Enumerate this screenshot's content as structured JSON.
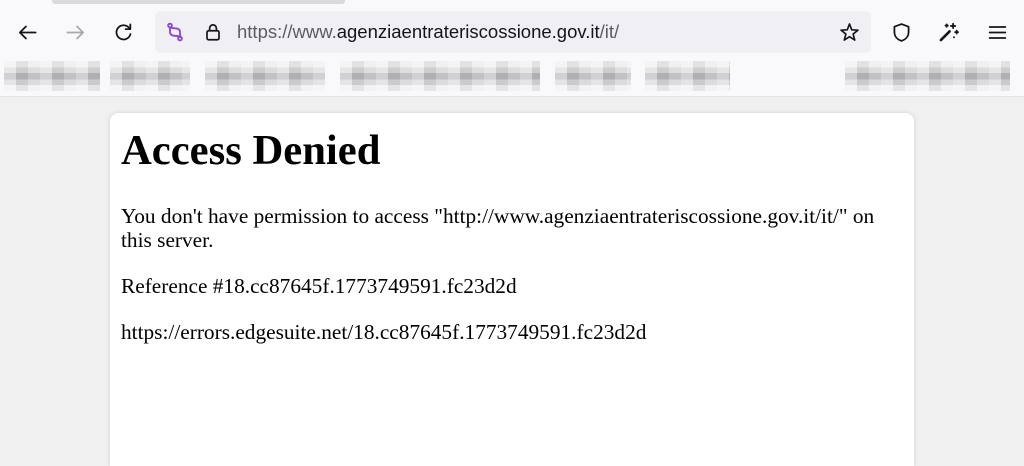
{
  "browser": {
    "toolbar": {
      "icons": {
        "back": "arrow-left-icon",
        "forward": "arrow-right-icon",
        "reload": "reload-icon",
        "page_action": "linked-nodes-icon",
        "security": "lock-icon",
        "bookmark": "star-icon",
        "tracking_protection": "shield-icon",
        "extension": "magic-wand-icon",
        "menu": "hamburger-menu-icon"
      },
      "forward_enabled": false
    },
    "address_bar": {
      "url_prefix": "https://www.",
      "url_domain": "agenziaentrateriscossione.gov.it",
      "url_path": "/it/"
    }
  },
  "page": {
    "heading": "Access Denied",
    "message": "You don't have permission to access \"http://www.agenziaentrateriscossione.gov.it/it/\" on this server.",
    "reference": "Reference #18.cc87645f.1773749591.fc23d2d",
    "error_url": "https://errors.edgesuite.net/18.cc87645f.1773749591.fc23d2d"
  },
  "colors": {
    "page_bg": "#f0f0f0",
    "toolbar_bg": "#f9f9fb",
    "urlbar_bg": "#f0f0f4",
    "icon": "#15141a",
    "icon_disabled": "#a8a8ad",
    "url_dim": "#5b5b66",
    "url_text": "#15141a",
    "accent_purple": "#8c47d9",
    "card_bg": "#ffffff",
    "text": "#000000"
  }
}
